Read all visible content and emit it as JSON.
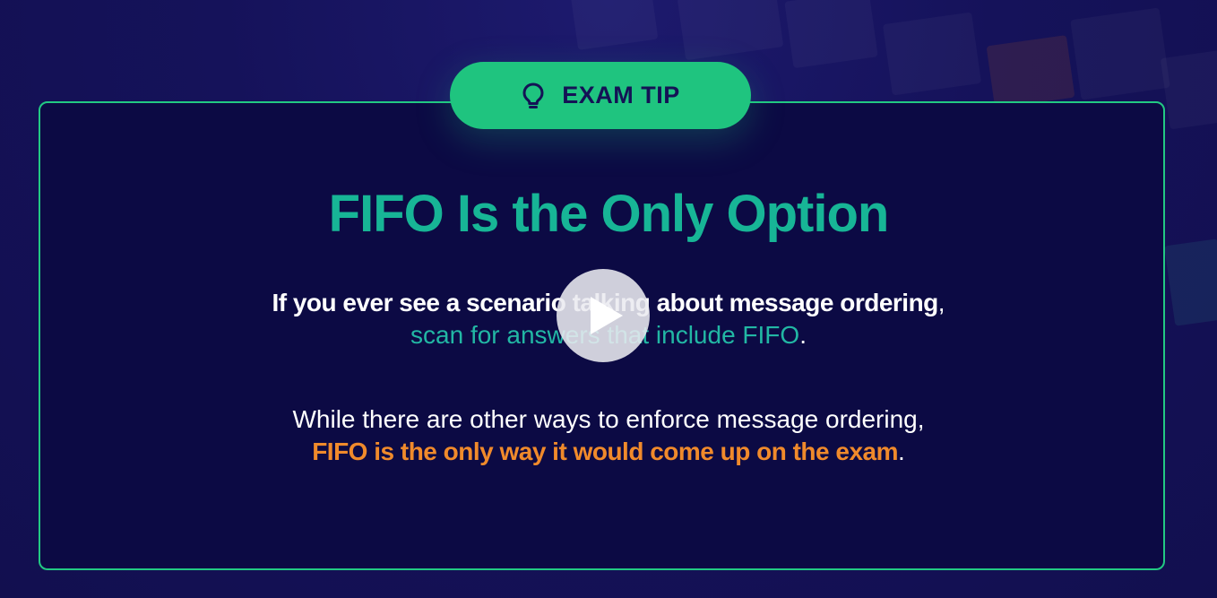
{
  "badge": {
    "label": "EXAM TIP",
    "icon": "lightbulb-icon"
  },
  "title": "FIFO Is the Only Option",
  "paragraph1": {
    "bold_text": "If you ever see a scenario talking about message ordering",
    "bold_punct": ",",
    "highlight_text": "scan for answers that include FIFO",
    "end_punct": "."
  },
  "paragraph2": {
    "text": "While there are other ways to enforce message ordering,",
    "highlight_text": "FIFO is the only way it would come up on the exam",
    "end_punct": "."
  },
  "player": {
    "icon": "play-icon"
  },
  "colors": {
    "accent_green": "#1fc47f",
    "title_teal": "#17b596",
    "highlight_teal": "#22b7a4",
    "highlight_orange": "#f08a2b",
    "card_bg": "#0c0a44",
    "page_bg": "#15125a"
  }
}
